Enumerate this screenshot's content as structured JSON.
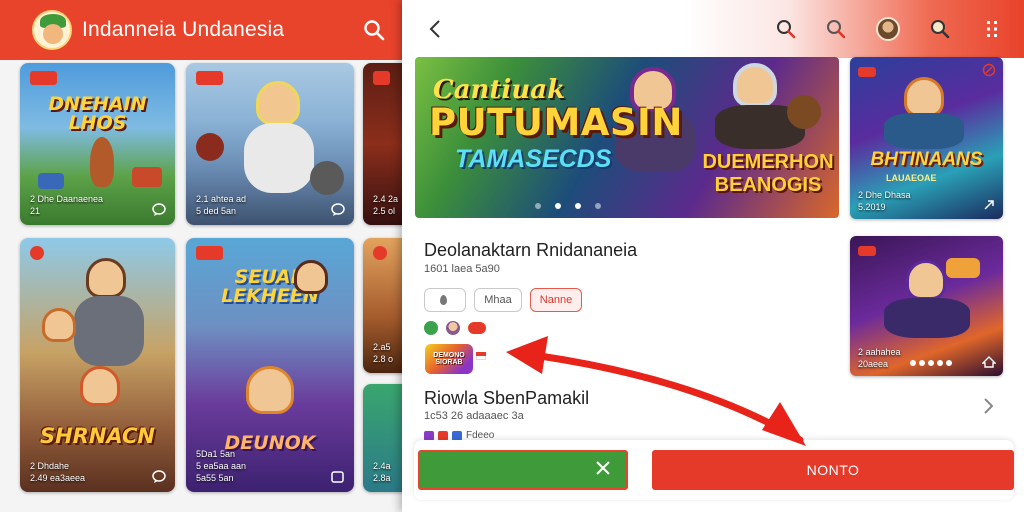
{
  "left_app": {
    "title": "Indanneia Undanesia",
    "cards": [
      {
        "tag": "",
        "big": "DNEHAIN LHOS",
        "meta1": "2 Dhe Daanaenea",
        "meta2": "21"
      },
      {
        "tag": "",
        "big": "",
        "meta1": "2.1 ahtea ad",
        "meta2": "5 ded 5an"
      },
      {
        "tag": "",
        "big": "",
        "meta1": "2.4 2a",
        "meta2": "2.5 ol"
      },
      {
        "tag": "",
        "big": "SHRNACN",
        "meta1": "2 Dhdahe",
        "meta2": "2.49 ea3aeea"
      },
      {
        "tag": "",
        "big": "SEUAK LEKHEEN",
        "big2": "DEUNOK",
        "meta1": "5Da1 5an",
        "meta2": "5 ea5aa aan",
        "meta3": "5a55 5an"
      },
      {
        "tag": "",
        "big": "",
        "meta1": "2.a5",
        "meta2": "2.8 o"
      },
      {
        "tag": "",
        "big": "",
        "meta1": "2.4a",
        "meta2": "2.8a"
      }
    ]
  },
  "detail": {
    "banner": {
      "line1": "Cantiuak",
      "line2": "PUTUMASIN",
      "line3": "TAMASECDS",
      "line4": "DUEMERHON BEANOGIS"
    },
    "side_card_1": {
      "big": "BHTINAANS",
      "sub": "LAUAEOAE",
      "meta1": "2 Dhe Dhasa",
      "meta2": "5.2019"
    },
    "side_card_2": {
      "meta1": "2 aahahea",
      "meta2": "20aeea"
    },
    "game_title": "Deolanaktarn Rnidananeia",
    "game_sub": "1601 laea 5a90",
    "pills": [
      "",
      "Mhaa",
      "Nanne"
    ],
    "game_logo_text": "DEMONO SIORAB",
    "section_title": "Riowla SbenPamakil",
    "section_sub": "1c53 26 adaaaec 3a",
    "section_extra": "Fdeeo",
    "red_button": "NONTO"
  },
  "colors": {
    "brand_red": "#e8432b",
    "button_red": "#e53a2a",
    "button_green": "#3f9a3a"
  },
  "icons": {
    "left_search": "search-icon",
    "back": "chevron-left-icon",
    "search1": "search-icon",
    "search2": "search-icon",
    "avatar": "avatar",
    "search3": "search-icon",
    "menu": "more-vertical-icon",
    "close": "close-icon",
    "chevron": "chevron-right-icon"
  }
}
